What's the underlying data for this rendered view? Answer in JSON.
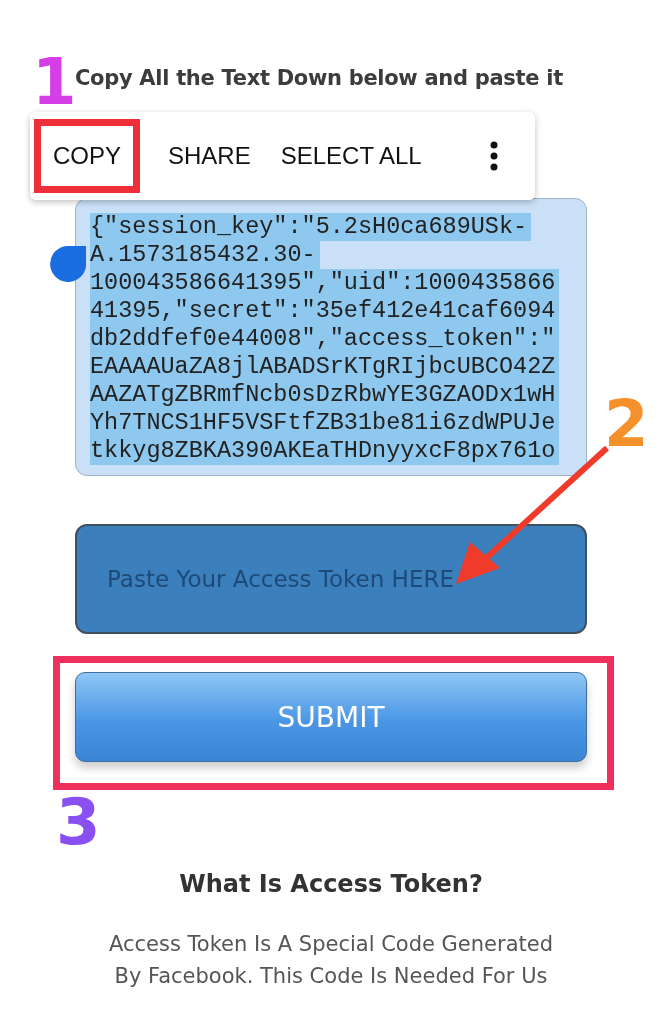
{
  "instruction": "Copy All the Text Down below and paste it",
  "text_menu": {
    "items": [
      {
        "label": "COPY",
        "highlighted": true
      },
      {
        "label": "SHARE",
        "highlighted": false
      },
      {
        "label": "SELECT ALL",
        "highlighted": false
      }
    ]
  },
  "token_box": {
    "text_selected": true,
    "lines": [
      "{\"session_key\":\"5.2sH0ca689USk-",
      "A.1573185432.30-",
      "100043586641395\",\"uid\":1000435866",
      "41395,\"secret\":\"35ef412e41caf6094",
      "db2ddfef0e44008\",\"access_token\":\"",
      "EAAAAUaZA8jlABADSrKTgRIjbcUBCO42Z",
      "AAZATgZBRmfNcb0sDzRbwYE3GZAODx1wH",
      "Yh7TNCS1HF5VSFtfZB31be81i6zdWPUJe",
      "tkkyg8ZBKA390AKEaTHDnyyxcF8px761o"
    ]
  },
  "token_input": {
    "placeholder": "Paste Your Access Token HERE"
  },
  "submit_button": {
    "label": "SUBMIT",
    "highlighted": true
  },
  "steps": [
    {
      "label": "1",
      "color": "#d63ee8"
    },
    {
      "label": "2",
      "color": "#f5902a"
    },
    {
      "label": "3",
      "color": "#8a4ff0"
    }
  ],
  "heading": "What Is Access Token?",
  "paragraph": "Access Token Is A Special Code Generated By Facebook. This Code Is Needed For Us"
}
